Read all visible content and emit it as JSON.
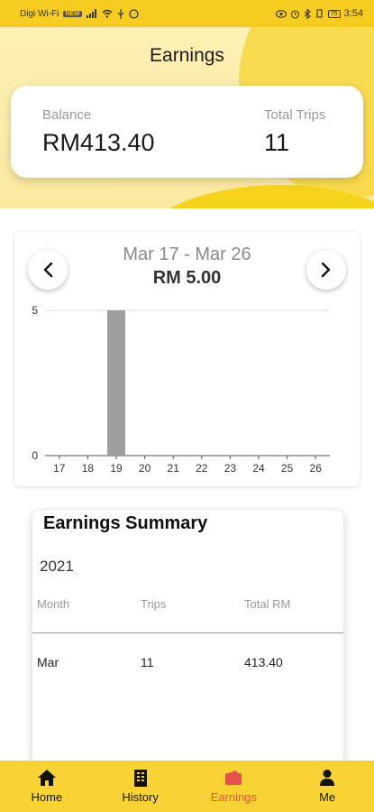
{
  "status_bar": {
    "carrier": "Digi Wi-Fi",
    "badge": "NEW",
    "battery": "75",
    "time": "3:54"
  },
  "header": {
    "title": "Earnings",
    "balance_label": "Balance",
    "balance_value": "RM413.40",
    "trips_label": "Total Trips",
    "trips_value": "11"
  },
  "chart_card": {
    "range": "Mar 17 - Mar 26",
    "total": "RM 5.00",
    "prev_icon": "chevron-left-icon",
    "next_icon": "chevron-right-icon"
  },
  "chart_data": {
    "type": "bar",
    "categories": [
      "17",
      "18",
      "19",
      "20",
      "21",
      "22",
      "23",
      "24",
      "25",
      "26"
    ],
    "values": [
      0,
      0,
      5,
      0,
      0,
      0,
      0,
      0,
      0,
      0
    ],
    "ylim": [
      0,
      5
    ],
    "yticks": [
      "0",
      "5"
    ],
    "grid": true,
    "bar_color": "#9e9e9e"
  },
  "summary": {
    "title": "Earnings Summary",
    "year": "2021",
    "headers": [
      "Month",
      "Trips",
      "Total RM"
    ],
    "rows": [
      [
        "Mar",
        "11",
        "413.40"
      ]
    ]
  },
  "bottom_nav": {
    "items": [
      {
        "label": "Home",
        "icon": "home-icon"
      },
      {
        "label": "History",
        "icon": "history-icon"
      },
      {
        "label": "Earnings",
        "icon": "wallet-icon",
        "active": true
      },
      {
        "label": "Me",
        "icon": "user-icon"
      }
    ],
    "active_color": "#e8524a"
  },
  "colors": {
    "accent": "#f5cc1f",
    "nav_bg": "#f7d433"
  }
}
